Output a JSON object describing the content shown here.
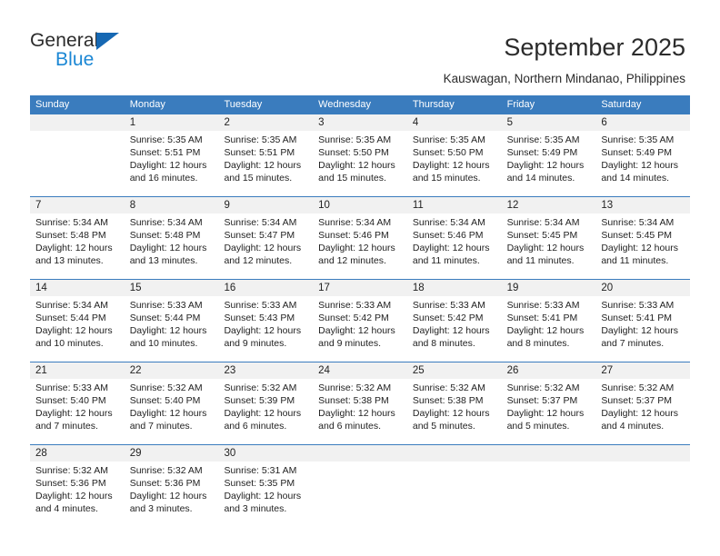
{
  "brand": {
    "name_top": "General",
    "name_bottom": "Blue",
    "accent_color": "#1668b3",
    "blue_text_color": "#1b87d4"
  },
  "header": {
    "title": "September 2025",
    "subtitle": "Kauswagan, Northern Mindanao, Philippines"
  },
  "calendar": {
    "header_bg": "#3a7cbe",
    "daynum_bg": "#f1f1f1",
    "weekdays": [
      "Sunday",
      "Monday",
      "Tuesday",
      "Wednesday",
      "Thursday",
      "Friday",
      "Saturday"
    ],
    "weeks": [
      [
        {
          "day": "",
          "lines": []
        },
        {
          "day": "1",
          "lines": [
            "Sunrise: 5:35 AM",
            "Sunset: 5:51 PM",
            "Daylight: 12 hours",
            "and 16 minutes."
          ]
        },
        {
          "day": "2",
          "lines": [
            "Sunrise: 5:35 AM",
            "Sunset: 5:51 PM",
            "Daylight: 12 hours",
            "and 15 minutes."
          ]
        },
        {
          "day": "3",
          "lines": [
            "Sunrise: 5:35 AM",
            "Sunset: 5:50 PM",
            "Daylight: 12 hours",
            "and 15 minutes."
          ]
        },
        {
          "day": "4",
          "lines": [
            "Sunrise: 5:35 AM",
            "Sunset: 5:50 PM",
            "Daylight: 12 hours",
            "and 15 minutes."
          ]
        },
        {
          "day": "5",
          "lines": [
            "Sunrise: 5:35 AM",
            "Sunset: 5:49 PM",
            "Daylight: 12 hours",
            "and 14 minutes."
          ]
        },
        {
          "day": "6",
          "lines": [
            "Sunrise: 5:35 AM",
            "Sunset: 5:49 PM",
            "Daylight: 12 hours",
            "and 14 minutes."
          ]
        }
      ],
      [
        {
          "day": "7",
          "lines": [
            "Sunrise: 5:34 AM",
            "Sunset: 5:48 PM",
            "Daylight: 12 hours",
            "and 13 minutes."
          ]
        },
        {
          "day": "8",
          "lines": [
            "Sunrise: 5:34 AM",
            "Sunset: 5:48 PM",
            "Daylight: 12 hours",
            "and 13 minutes."
          ]
        },
        {
          "day": "9",
          "lines": [
            "Sunrise: 5:34 AM",
            "Sunset: 5:47 PM",
            "Daylight: 12 hours",
            "and 12 minutes."
          ]
        },
        {
          "day": "10",
          "lines": [
            "Sunrise: 5:34 AM",
            "Sunset: 5:46 PM",
            "Daylight: 12 hours",
            "and 12 minutes."
          ]
        },
        {
          "day": "11",
          "lines": [
            "Sunrise: 5:34 AM",
            "Sunset: 5:46 PM",
            "Daylight: 12 hours",
            "and 11 minutes."
          ]
        },
        {
          "day": "12",
          "lines": [
            "Sunrise: 5:34 AM",
            "Sunset: 5:45 PM",
            "Daylight: 12 hours",
            "and 11 minutes."
          ]
        },
        {
          "day": "13",
          "lines": [
            "Sunrise: 5:34 AM",
            "Sunset: 5:45 PM",
            "Daylight: 12 hours",
            "and 11 minutes."
          ]
        }
      ],
      [
        {
          "day": "14",
          "lines": [
            "Sunrise: 5:34 AM",
            "Sunset: 5:44 PM",
            "Daylight: 12 hours",
            "and 10 minutes."
          ]
        },
        {
          "day": "15",
          "lines": [
            "Sunrise: 5:33 AM",
            "Sunset: 5:44 PM",
            "Daylight: 12 hours",
            "and 10 minutes."
          ]
        },
        {
          "day": "16",
          "lines": [
            "Sunrise: 5:33 AM",
            "Sunset: 5:43 PM",
            "Daylight: 12 hours",
            "and 9 minutes."
          ]
        },
        {
          "day": "17",
          "lines": [
            "Sunrise: 5:33 AM",
            "Sunset: 5:42 PM",
            "Daylight: 12 hours",
            "and 9 minutes."
          ]
        },
        {
          "day": "18",
          "lines": [
            "Sunrise: 5:33 AM",
            "Sunset: 5:42 PM",
            "Daylight: 12 hours",
            "and 8 minutes."
          ]
        },
        {
          "day": "19",
          "lines": [
            "Sunrise: 5:33 AM",
            "Sunset: 5:41 PM",
            "Daylight: 12 hours",
            "and 8 minutes."
          ]
        },
        {
          "day": "20",
          "lines": [
            "Sunrise: 5:33 AM",
            "Sunset: 5:41 PM",
            "Daylight: 12 hours",
            "and 7 minutes."
          ]
        }
      ],
      [
        {
          "day": "21",
          "lines": [
            "Sunrise: 5:33 AM",
            "Sunset: 5:40 PM",
            "Daylight: 12 hours",
            "and 7 minutes."
          ]
        },
        {
          "day": "22",
          "lines": [
            "Sunrise: 5:32 AM",
            "Sunset: 5:40 PM",
            "Daylight: 12 hours",
            "and 7 minutes."
          ]
        },
        {
          "day": "23",
          "lines": [
            "Sunrise: 5:32 AM",
            "Sunset: 5:39 PM",
            "Daylight: 12 hours",
            "and 6 minutes."
          ]
        },
        {
          "day": "24",
          "lines": [
            "Sunrise: 5:32 AM",
            "Sunset: 5:38 PM",
            "Daylight: 12 hours",
            "and 6 minutes."
          ]
        },
        {
          "day": "25",
          "lines": [
            "Sunrise: 5:32 AM",
            "Sunset: 5:38 PM",
            "Daylight: 12 hours",
            "and 5 minutes."
          ]
        },
        {
          "day": "26",
          "lines": [
            "Sunrise: 5:32 AM",
            "Sunset: 5:37 PM",
            "Daylight: 12 hours",
            "and 5 minutes."
          ]
        },
        {
          "day": "27",
          "lines": [
            "Sunrise: 5:32 AM",
            "Sunset: 5:37 PM",
            "Daylight: 12 hours",
            "and 4 minutes."
          ]
        }
      ],
      [
        {
          "day": "28",
          "lines": [
            "Sunrise: 5:32 AM",
            "Sunset: 5:36 PM",
            "Daylight: 12 hours",
            "and 4 minutes."
          ]
        },
        {
          "day": "29",
          "lines": [
            "Sunrise: 5:32 AM",
            "Sunset: 5:36 PM",
            "Daylight: 12 hours",
            "and 3 minutes."
          ]
        },
        {
          "day": "30",
          "lines": [
            "Sunrise: 5:31 AM",
            "Sunset: 5:35 PM",
            "Daylight: 12 hours",
            "and 3 minutes."
          ]
        },
        {
          "day": "",
          "lines": []
        },
        {
          "day": "",
          "lines": []
        },
        {
          "day": "",
          "lines": []
        },
        {
          "day": "",
          "lines": []
        }
      ]
    ]
  }
}
